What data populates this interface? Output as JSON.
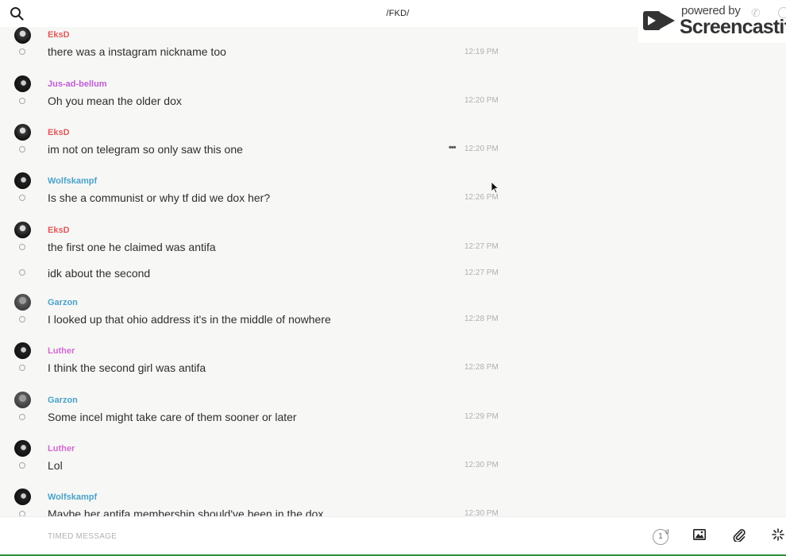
{
  "header": {
    "channel_title": "/FKD/"
  },
  "watermark": {
    "powered_by": "powered by",
    "brand": "Screencastify"
  },
  "messages": [
    {
      "author": "EksD",
      "author_color": "#e05a5a",
      "text": "there was a instagram nickname too",
      "time": "12:19 PM"
    },
    {
      "author": "Jus-ad-bellum",
      "author_color": "#c15bd6",
      "text": "Oh you mean the older dox",
      "time": "12:20 PM"
    },
    {
      "author": "EksD",
      "author_color": "#e05a5a",
      "text": "im not on telegram so only saw this one",
      "time": "12:20 PM",
      "more": "•••"
    },
    {
      "author": "Wolfskampf",
      "author_color": "#4aa3c8",
      "text": "Is she a communist or why tf did we dox her?",
      "time": "12:26 PM"
    },
    {
      "author": "EksD",
      "author_color": "#e05a5a",
      "text": "the first one he claimed was antifa",
      "time": "12:27 PM"
    },
    {
      "author": "",
      "author_color": "",
      "text": "idk about the second",
      "time": "12:27 PM"
    },
    {
      "author": "Garzon",
      "author_color": "#4aa3c8",
      "text": "I looked up that ohio address it's in the middle of nowhere",
      "time": "12:28 PM"
    },
    {
      "author": "Luther",
      "author_color": "#d46ad1",
      "text": "I think the second girl was antifa",
      "time": "12:28 PM"
    },
    {
      "author": "Garzon",
      "author_color": "#4aa3c8",
      "text": "Some incel might take care of them sooner or later",
      "time": "12:29 PM"
    },
    {
      "author": "Luther",
      "author_color": "#d46ad1",
      "text": "Lol",
      "time": "12:30 PM"
    },
    {
      "author": "Wolfskampf",
      "author_color": "#4aa3c8",
      "text": "Maybe her antifa membership should've been in the dox",
      "time": "12:30 PM"
    }
  ],
  "composer": {
    "placeholder": "TIMED MESSAGE",
    "timer_value": "1",
    "timer_unit": "d"
  },
  "icons": {
    "search": "search-icon",
    "image": "image-icon",
    "attach": "paperclip-icon",
    "effects": "sparkle-icon"
  }
}
